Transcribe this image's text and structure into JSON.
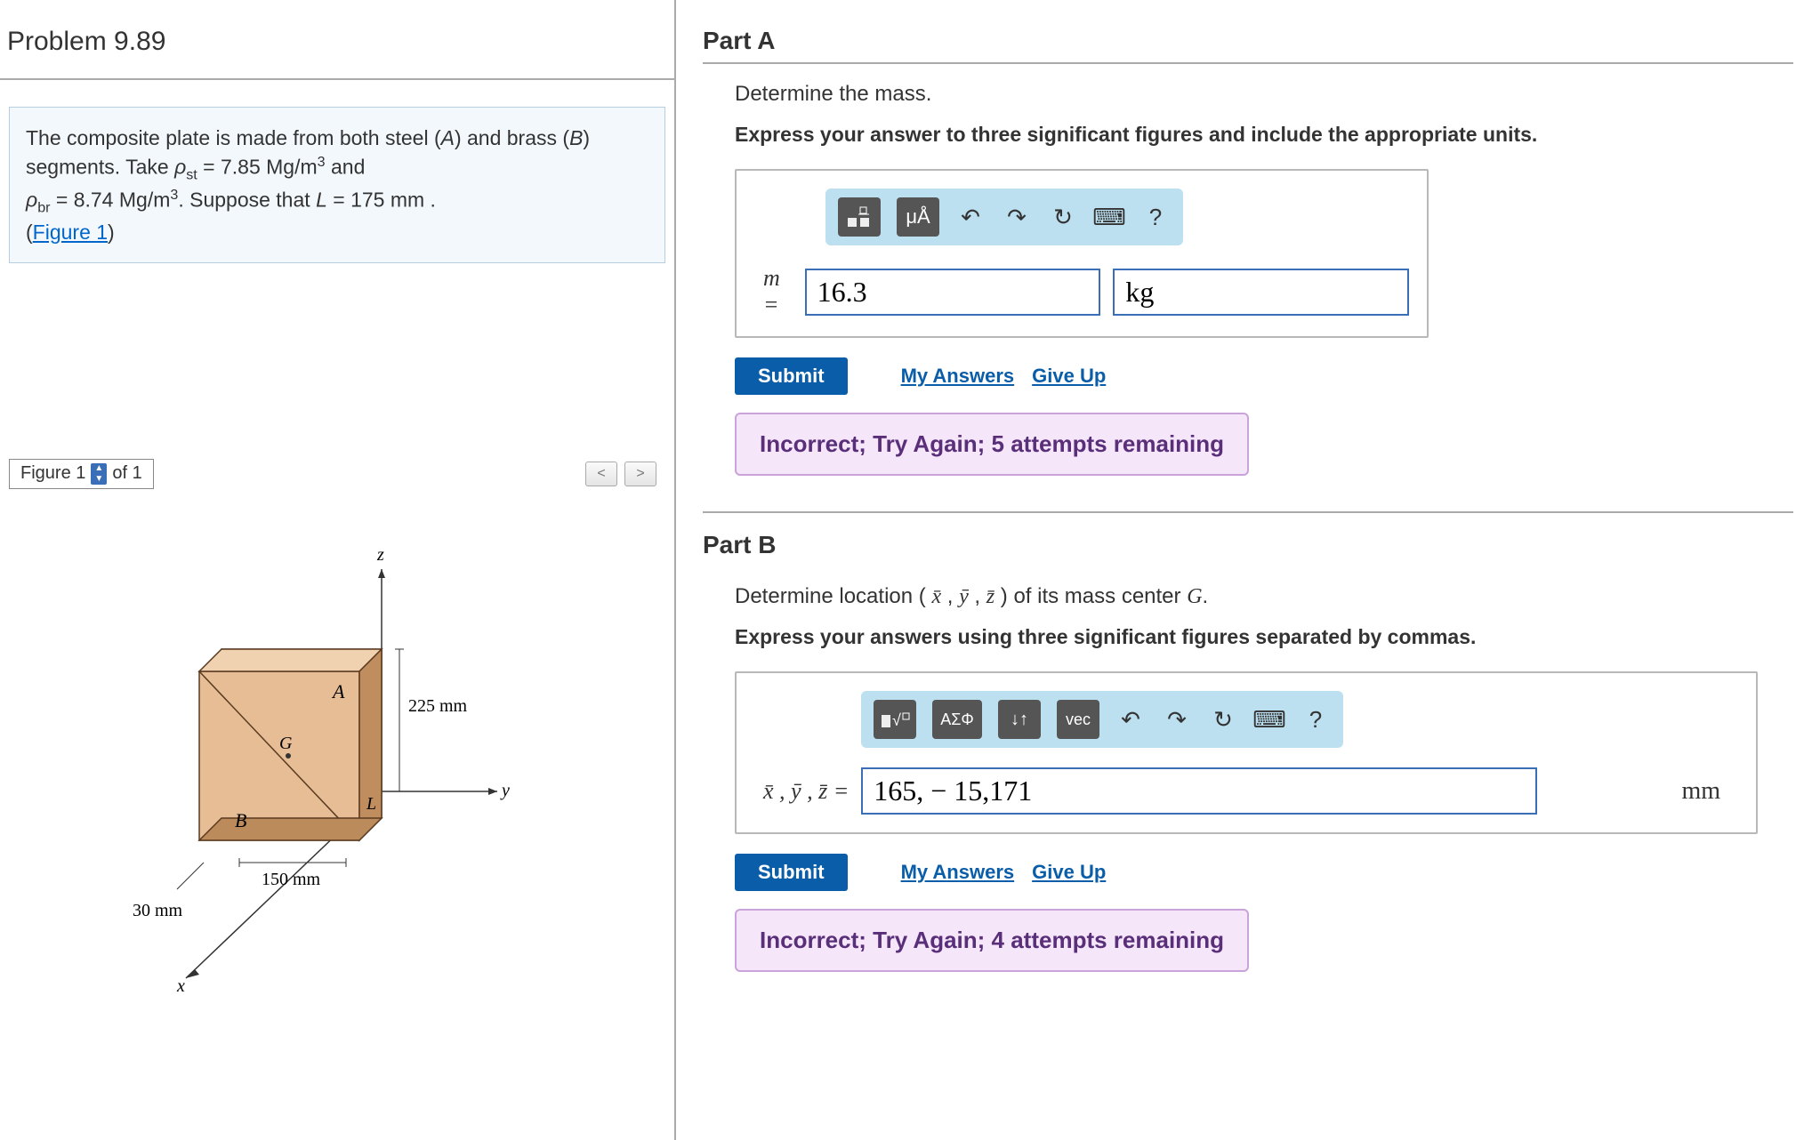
{
  "problem": {
    "id": "Problem 9.89",
    "text_lines": [
      "The composite plate is made from both steel (",
      "A",
      ") and brass (",
      "B",
      ") segments. Take "
    ],
    "rho_st_label": "ρ",
    "rho_st_sub": "st",
    "rho_st_val": " = 7.85 Mg/m",
    "rho_br_label": "ρ",
    "rho_br_sub": "br",
    "rho_br_val": " = 8.74 Mg/m",
    "cube": "3",
    "and": " and ",
    "suppose": ". Suppose that ",
    "L_label": "L",
    "L_val": " = 175  mm .",
    "figure_link": "Figure 1"
  },
  "figure_bar": {
    "label": "Figure 1",
    "of": "of 1",
    "prev": "<",
    "next": ">"
  },
  "figure": {
    "label_z": "z",
    "label_y": "y",
    "label_x": "x",
    "label_A": "A",
    "label_B": "B",
    "label_G": "G",
    "label_L": "L",
    "dim_225": "225 mm",
    "dim_150": "150 mm",
    "dim_30": "30 mm"
  },
  "partA": {
    "title": "Part A",
    "instr": "Determine the mass.",
    "bold_instr": "Express your answer to three significant figures and include the appropriate units.",
    "toolbar": {
      "template": "□°/□",
      "units": "μÅ",
      "undo": "↶",
      "redo": "↷",
      "reset": "↻",
      "keyboard": "⌨",
      "help": "?"
    },
    "var": "m = ",
    "value": "16.3",
    "unit": "kg",
    "submit": "Submit",
    "my_answers": "My Answers",
    "give_up": "Give Up",
    "feedback": "Incorrect; Try Again; 5 attempts remaining"
  },
  "partB": {
    "title": "Part B",
    "instr1": "Determine location ( ",
    "xbar": "x̄",
    "ybar": "ȳ",
    "zbar": "z̄",
    "instr2": " ) of its mass center ",
    "G": "G",
    "period": ".",
    "bold_instr": "Express your answers using three significant figures separated by commas.",
    "toolbar": {
      "template": "■√□",
      "greek": "ΑΣΦ",
      "sort": "↓↑",
      "vec": "vec",
      "undo": "↶",
      "redo": "↷",
      "reset": "↻",
      "keyboard": "⌨",
      "help": "?"
    },
    "var": "x̄ , ȳ , z̄  = ",
    "value": "165, − 15,171",
    "unit": "mm",
    "submit": "Submit",
    "my_answers": "My Answers",
    "give_up": "Give Up",
    "feedback": "Incorrect; Try Again; 4 attempts remaining"
  }
}
